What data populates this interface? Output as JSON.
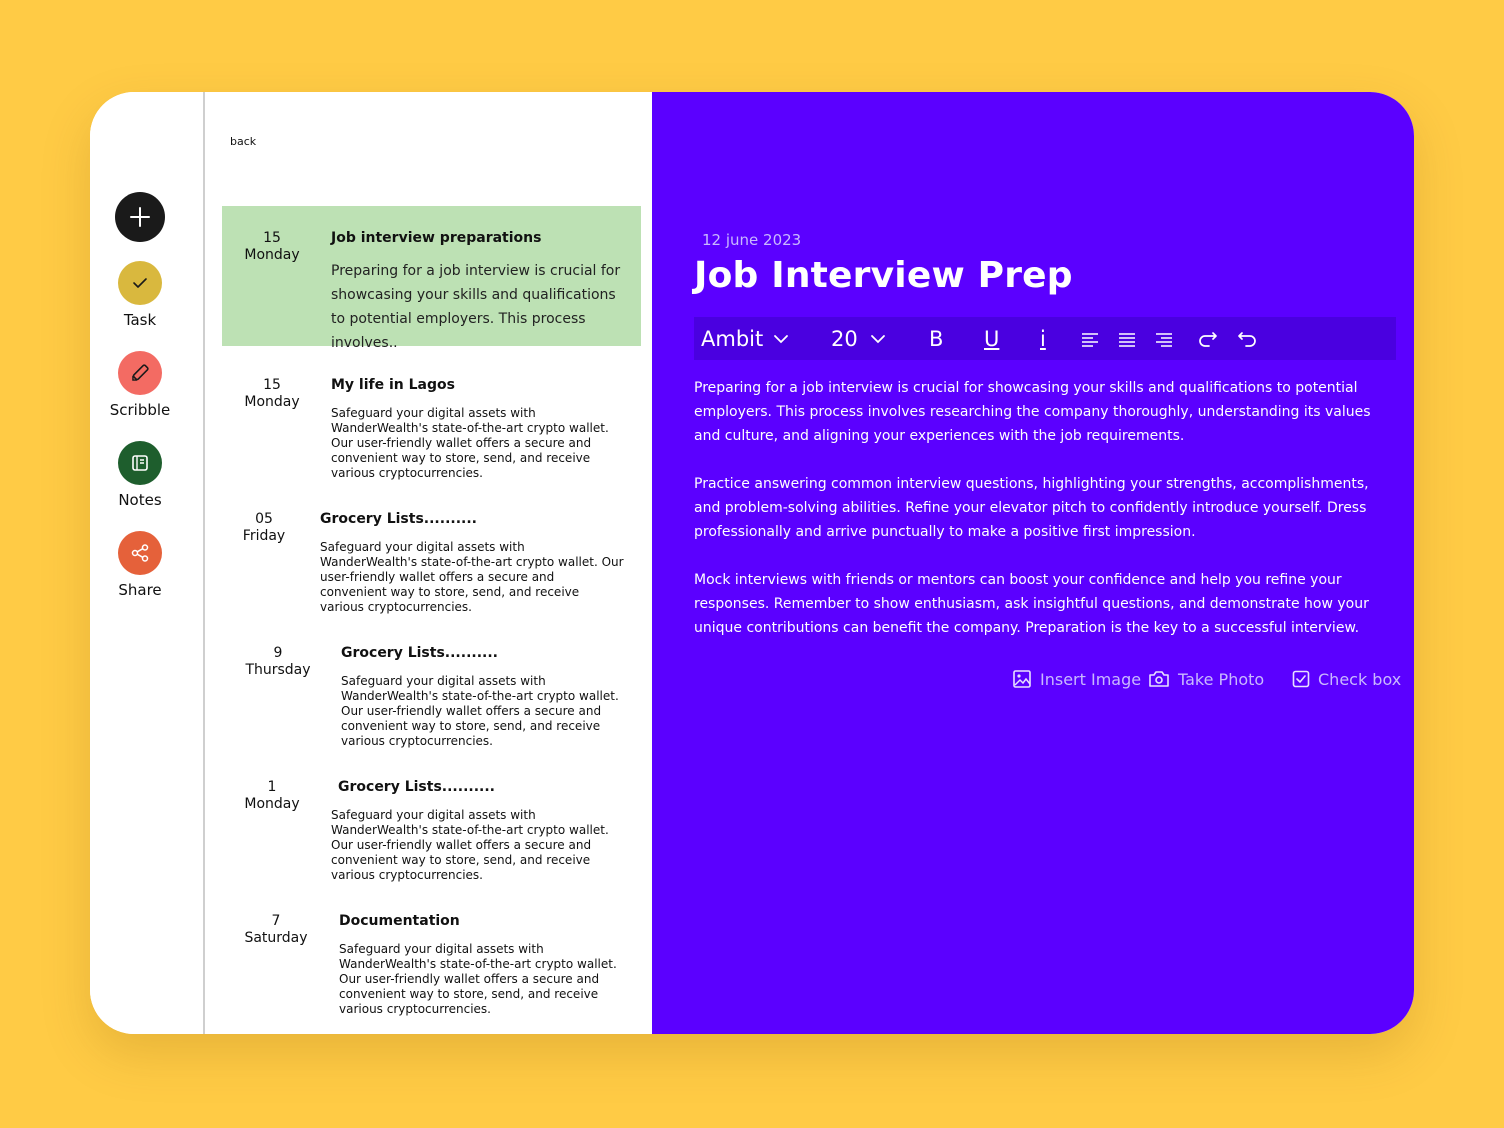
{
  "sidebar": {
    "items": [
      {
        "label": "Task",
        "icon": "check-icon",
        "color": "#D9B83E"
      },
      {
        "label": "Scribble",
        "icon": "pencil-icon",
        "color": "#F36B63"
      },
      {
        "label": "Notes",
        "icon": "notebook-icon",
        "color": "#1E5E2D"
      },
      {
        "label": "Share",
        "icon": "share-icon",
        "color": "#E5613A"
      }
    ]
  },
  "list": {
    "back_label": "back",
    "notes": [
      {
        "day": "15",
        "weekday": "Monday",
        "title": "Job interview preparations",
        "body": "Preparing for a job interview is crucial for showcasing your skills and qualifications to potential employers. This process involves.."
      },
      {
        "day": "15",
        "weekday": "Monday",
        "title": "My life in Lagos",
        "body": "Safeguard your digital assets with WanderWealth's state-of-the-art crypto wallet. Our user-friendly wallet offers a secure and convenient way to store, send, and receive various cryptocurrencies."
      },
      {
        "day": "05",
        "weekday": "Friday",
        "title": "Grocery Lists..........",
        "body": "Safeguard your digital assets with WanderWealth's state-of-the-art crypto wallet. Our user-friendly wallet offers a secure and convenient way to store, send, and receive various cryptocurrencies."
      },
      {
        "day": "9",
        "weekday": "Thursday",
        "title": "Grocery Lists..........",
        "body": "Safeguard your digital assets with WanderWealth's state-of-the-art crypto wallet. Our user-friendly wallet offers a secure and convenient way to store, send, and receive various cryptocurrencies."
      },
      {
        "day": "1",
        "weekday": "Monday",
        "title": "Grocery Lists..........",
        "body": "Safeguard your digital assets with WanderWealth's state-of-the-art crypto wallet. Our user-friendly wallet offers a secure and convenient way to store, send, and receive various cryptocurrencies."
      },
      {
        "day": "7",
        "weekday": "Saturday",
        "title": "Documentation",
        "body": "Safeguard your digital assets with WanderWealth's state-of-the-art crypto wallet. Our user-friendly wallet offers a secure and convenient way to store, send, and receive various cryptocurrencies."
      }
    ]
  },
  "editor": {
    "date": "12 june 2023",
    "title": "Job Interview Prep",
    "toolbar": {
      "font": "Ambit",
      "size": "20",
      "bold": "B",
      "underline": "U",
      "italic": "i"
    },
    "paragraphs": [
      "Preparing for a job interview is crucial for showcasing your skills and qualifications to potential employers. This process involves researching the company thoroughly, understanding its values and culture, and aligning your experiences with the job requirements.",
      "Practice answering common interview questions, highlighting your strengths, accomplishments, and problem-solving abilities. Refine your elevator pitch to confidently introduce yourself. Dress professionally and arrive punctually to make a positive first impression.",
      "Mock interviews with friends or mentors can boost your confidence and help you refine your responses. Remember to show enthusiasm, ask insightful questions, and demonstrate how your unique contributions can benefit the company. Preparation is the key to a successful interview."
    ],
    "actions": {
      "insert_image": "Insert Image",
      "take_photo": "Take Photo",
      "check_box": "Check box"
    }
  },
  "colors": {
    "background": "#FFCB45",
    "editor": "#5B00FF",
    "active_card": "#BDE1B4"
  }
}
